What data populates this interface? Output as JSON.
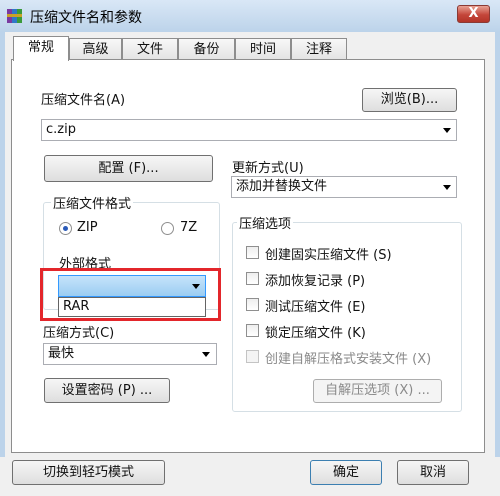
{
  "window": {
    "title": "压缩文件名和参数",
    "close": "X"
  },
  "tabs": [
    {
      "label": "常规"
    },
    {
      "label": "高级"
    },
    {
      "label": "文件"
    },
    {
      "label": "备份"
    },
    {
      "label": "时间"
    },
    {
      "label": "注释"
    }
  ],
  "archive": {
    "name_label": "压缩文件名(A)",
    "browse_button": "浏览(B)...",
    "name_value": "c.zip"
  },
  "profiles_button": "配置 (F)...",
  "update": {
    "label": "更新方式(U)",
    "value": "添加并替换文件"
  },
  "format": {
    "legend": "压缩文件格式",
    "zip": "ZIP",
    "seven_z": "7Z",
    "external_label": "外部格式",
    "external_value": "",
    "dropdown_option": "RAR"
  },
  "method": {
    "label": "压缩方式(C)",
    "value": "最快"
  },
  "password_button": "设置密码 (P) ...",
  "options": {
    "legend": "压缩选项",
    "items": [
      "创建固实压缩文件 (S)",
      "添加恢复记录 (P)",
      "测试压缩文件 (E)",
      "锁定压缩文件 (K)",
      "创建自解压格式安装文件 (X)"
    ],
    "sfx_button": "自解压选项 (X) ..."
  },
  "footer": {
    "wizard_button": "切换到轻巧模式",
    "ok_button": "确定",
    "cancel_button": "取消"
  },
  "colors": {
    "annotation": "#e3262b",
    "title_bar": "#bcd3ea",
    "focus": "#3399ff"
  }
}
